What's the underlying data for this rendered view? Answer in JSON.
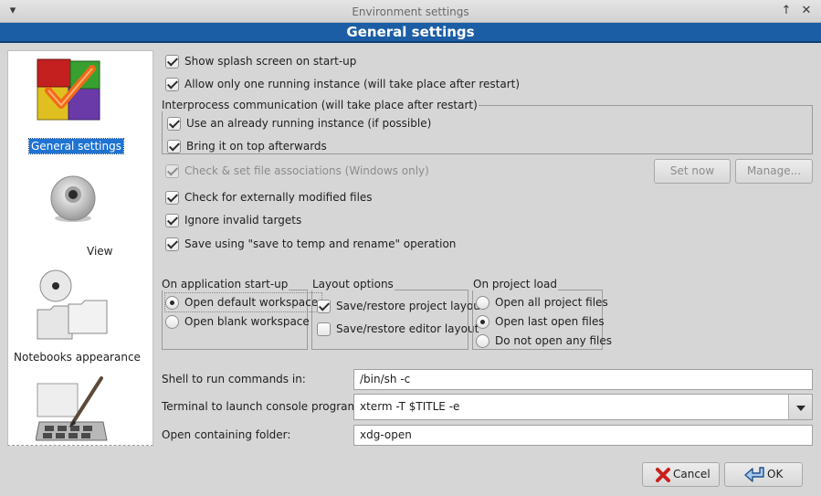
{
  "window": {
    "title": "Environment settings",
    "header": "General settings"
  },
  "sidebar": {
    "items": [
      {
        "label": "General settings",
        "icon": "general-settings-icon",
        "selected": true
      },
      {
        "label": "View",
        "icon": "view-icon",
        "selected": false
      },
      {
        "label": "Notebooks appearance",
        "icon": "notebooks-appearance-icon",
        "selected": false
      },
      {
        "label": "",
        "icon": "colours-icon",
        "selected": false
      }
    ]
  },
  "options": {
    "splash": {
      "label": "Show splash screen on start-up",
      "checked": true
    },
    "single_instance": {
      "label": "Allow only one running instance (will take place after restart)",
      "checked": true
    },
    "ipc": {
      "title": "Interprocess communication (will take place after restart)",
      "use_running": {
        "label": "Use an already running instance (if possible)",
        "checked": true
      },
      "bring_top": {
        "label": "Bring it on top afterwards",
        "checked": true
      }
    },
    "file_assoc": {
      "label": "Check & set file associations (Windows only)",
      "checked": true,
      "disabled": true
    },
    "set_now_label": "Set now",
    "manage_label": "Manage...",
    "ext_modified": {
      "label": "Check for externally modified files",
      "checked": true
    },
    "ignore_invalid": {
      "label": "Ignore invalid targets",
      "checked": true
    },
    "save_temp": {
      "label": "Save using \"save to temp and rename\" operation",
      "checked": true
    }
  },
  "startup_group": {
    "title": "On application start-up",
    "open_default": "Open default workspace",
    "open_blank": "Open blank workspace",
    "selected": "open_default"
  },
  "layout_group": {
    "title": "Layout options",
    "save_project_layout": {
      "label": "Save/restore project layout",
      "checked": true
    },
    "save_editor_layout": {
      "label": "Save/restore editor layout",
      "checked": false
    }
  },
  "project_group": {
    "title": "On project load",
    "open_all": "Open all project files",
    "open_last": "Open last open files",
    "open_none": "Do not open any files",
    "selected": "open_last"
  },
  "fields": {
    "shell_label": "Shell to run commands in:",
    "shell_value": "/bin/sh -c",
    "terminal_label": "Terminal to launch console programs:",
    "terminal_value": "xterm -T $TITLE -e",
    "folder_label": "Open containing folder:",
    "folder_value": "xdg-open"
  },
  "footer": {
    "cancel_label": "Cancel",
    "ok_label": "OK"
  },
  "colors": {
    "header_bg": "#1b5ea6",
    "selection": "#1f73d2",
    "window_bg": "#d6d6d6"
  }
}
